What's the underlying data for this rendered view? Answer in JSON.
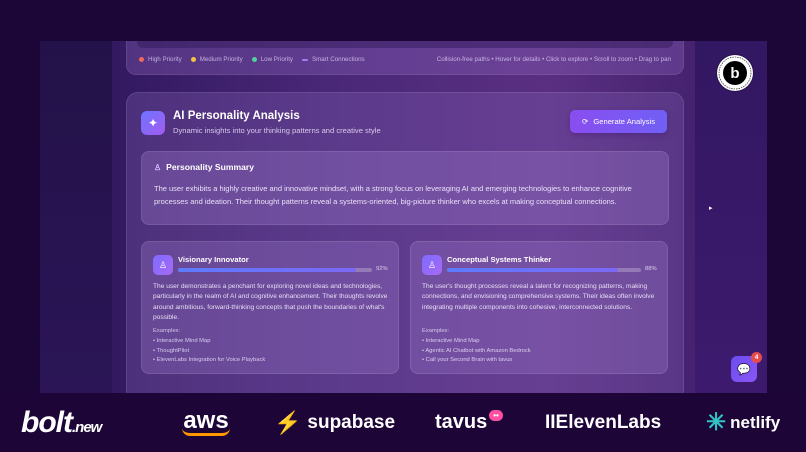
{
  "legend": {
    "items": [
      {
        "label": "High Priority",
        "color": "#f06a5a",
        "kind": "dot"
      },
      {
        "label": "Medium Priority",
        "color": "#f5c342",
        "kind": "dot"
      },
      {
        "label": "Low Priority",
        "color": "#4fd39a",
        "kind": "dot"
      },
      {
        "label": "Smart Connections",
        "color": "#a77bf0",
        "kind": "line"
      }
    ],
    "hint": "Collision-free paths • Hover for details • Click to explore • Scroll to zoom • Drag to pan"
  },
  "analysis": {
    "title": "AI Personality Analysis",
    "subtitle": "Dynamic insights into your thinking patterns and creative style",
    "generate_button": "Generate Analysis",
    "summary": {
      "title": "Personality Summary",
      "text": "The user exhibits a highly creative and innovative mindset, with a strong focus on leveraging AI and emerging technologies to enhance cognitive processes and ideation. Their thought patterns reveal a systems-oriented, big-picture thinker who excels at making conceptual connections."
    },
    "traits": [
      {
        "name": "Visionary Innovator",
        "percent_label": "92%",
        "percent": 92,
        "description": "The user demonstrates a penchant for exploring novel ideas and technologies, particularly in the realm of AI and cognitive enhancement. Their thoughts revolve around ambitious, forward-thinking concepts that push the boundaries of what's possible.",
        "examples_label": "Examples:",
        "examples": [
          "• Interactive Mind Map",
          "• ThoughtPilot",
          "• ElevenLabs Integration for Voice Playback"
        ]
      },
      {
        "name": "Conceptual Systems Thinker",
        "percent_label": "88%",
        "percent": 88,
        "description": "The user's thought processes reveal a talent for recognizing patterns, making connections, and envisioning comprehensive systems. Their ideas often involve integrating multiple components into cohesive, interconnected solutions.",
        "examples_label": "Examples:",
        "examples": [
          "• Interactive Mind Map",
          "• Agentic AI Chatbot with Amazon Bedrock",
          "• Call your Second Brain with tavus"
        ]
      }
    ]
  },
  "badge": {
    "letter": "b",
    "ring_text": "POWERED BY BOLT.NEW • MADE IN BOLT •"
  },
  "chat": {
    "icon": "chat-bubble-icon",
    "count": "4"
  },
  "sponsors": {
    "bolt": "bolt",
    "bolt_suffix": ".new",
    "aws": "aws",
    "supabase": "supabase",
    "tavus": "tavus",
    "tavus_pill": "••",
    "elevenlabs": "IIElevenLabs",
    "netlify": "netlify"
  }
}
